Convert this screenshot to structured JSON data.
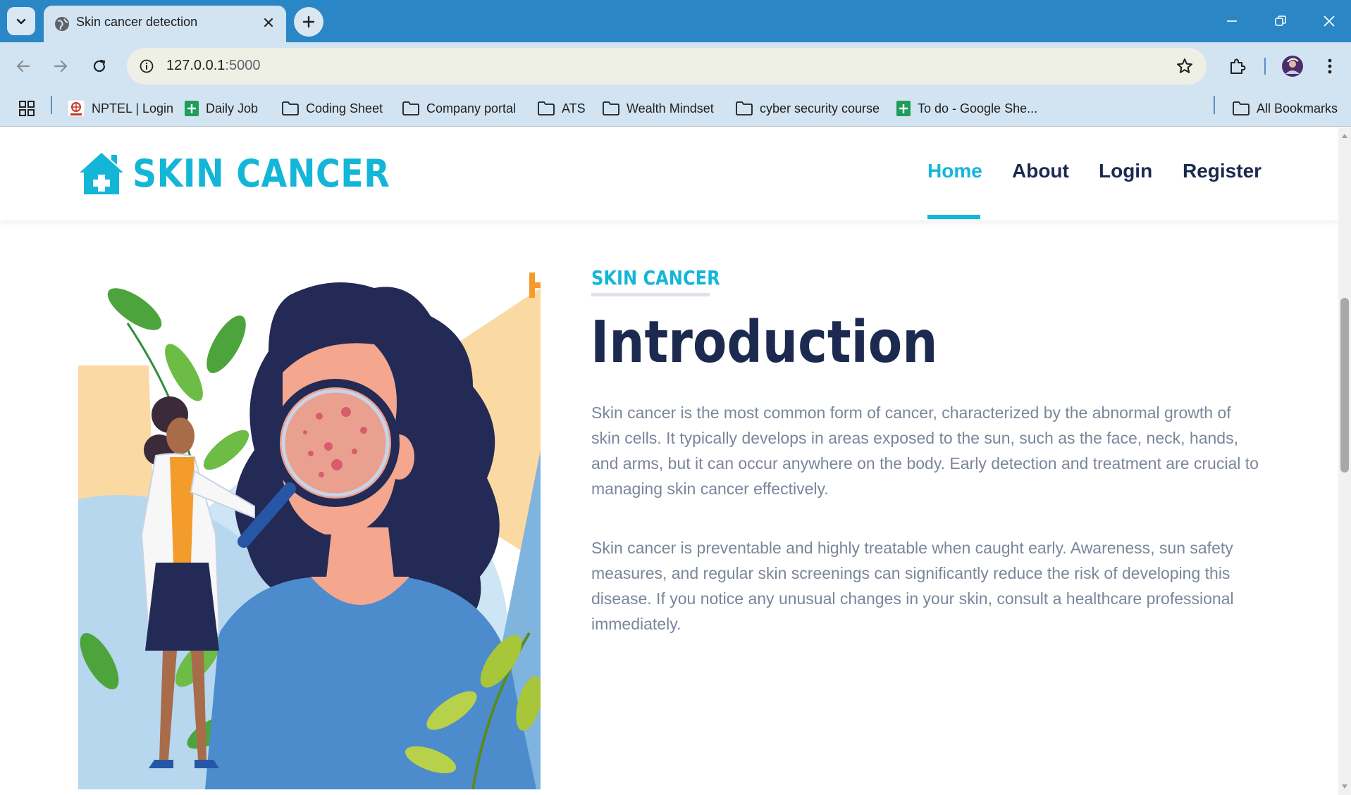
{
  "browser": {
    "tab_title": "Skin cancer detection",
    "url_host": "127.0.0.1",
    "url_port": ":5000",
    "bookmarks": [
      {
        "label": "NPTEL | Login",
        "icon": "nptel-icon"
      },
      {
        "label": "Daily Job",
        "icon": "sheets-icon"
      },
      {
        "label": "Coding Sheet",
        "icon": "folder-icon"
      },
      {
        "label": "Company portal",
        "icon": "folder-icon"
      },
      {
        "label": "ATS",
        "icon": "folder-icon"
      },
      {
        "label": "Wealth Mindset",
        "icon": "folder-icon"
      },
      {
        "label": "cyber security course",
        "icon": "folder-icon"
      },
      {
        "label": "To do - Google She...",
        "icon": "sheets-icon"
      }
    ],
    "all_bookmarks": "All Bookmarks"
  },
  "site": {
    "brand": "SKIN CANCER",
    "nav": [
      "Home",
      "About",
      "Login",
      "Register"
    ],
    "active_nav": "Home"
  },
  "intro": {
    "eyebrow": "SKIN CANCER",
    "title": "Introduction",
    "paragraph1": "Skin cancer is the most common form of cancer, characterized by the abnormal growth of skin cells. It typically develops in areas exposed to the sun, such as the face, neck, hands, and arms, but it can occur anywhere on the body. Early detection and treatment are crucial to managing skin cancer effectively.",
    "paragraph2": "Skin cancer is preventable and highly treatable when caught early. Awareness, sun safety measures, and regular skin screenings can significantly reduce the risk of developing this disease. If you notice any unusual changes in your skin, consult a healthcare professional immediately."
  },
  "colors": {
    "accent": "#14b6d8",
    "navy": "#1b2a4e",
    "body_text": "#7b869a",
    "browser_frame": "#2b86c5"
  }
}
